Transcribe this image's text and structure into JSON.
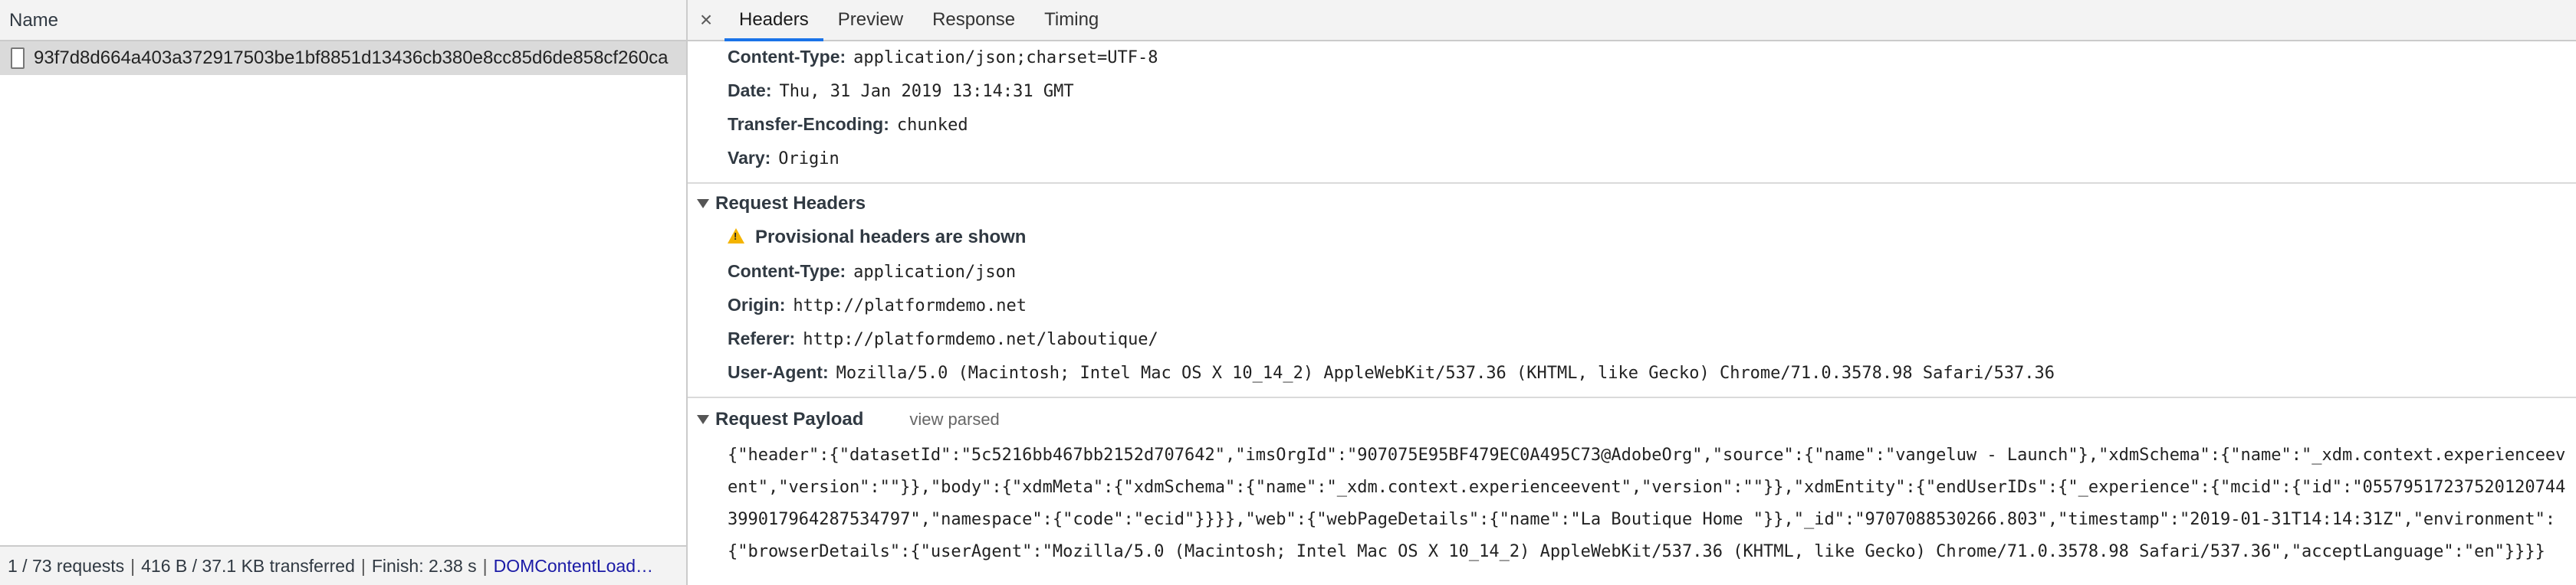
{
  "left": {
    "column_header": "Name",
    "request_name": "93f7d8d664a403a372917503be1bf8851d13436cb380e8cc85d6de858cf260ca",
    "status": {
      "requests": "1 / 73 requests",
      "transferred": "416 B / 37.1 KB transferred",
      "finish": "Finish: 2.38 s",
      "dom_content_loaded": "DOMContentLoad…"
    }
  },
  "tabs": {
    "close": "×",
    "headers": "Headers",
    "preview": "Preview",
    "response": "Response",
    "timing": "Timing"
  },
  "response_headers": [
    {
      "name": "Content-Type:",
      "value": "application/json;charset=UTF-8"
    },
    {
      "name": "Date:",
      "value": "Thu, 31 Jan 2019 13:14:31 GMT"
    },
    {
      "name": "Transfer-Encoding:",
      "value": "chunked"
    },
    {
      "name": "Vary:",
      "value": "Origin"
    }
  ],
  "request_headers": {
    "title": "Request Headers",
    "warning": "Provisional headers are shown",
    "items": [
      {
        "name": "Content-Type:",
        "value": "application/json"
      },
      {
        "name": "Origin:",
        "value": "http://platformdemo.net"
      },
      {
        "name": "Referer:",
        "value": "http://platformdemo.net/laboutique/"
      },
      {
        "name": "User-Agent:",
        "value": "Mozilla/5.0 (Macintosh; Intel Mac OS X 10_14_2) AppleWebKit/537.36 (KHTML, like Gecko) Chrome/71.0.3578.98 Safari/537.36"
      }
    ]
  },
  "request_payload": {
    "title": "Request Payload",
    "view_parsed": "view parsed",
    "lines": [
      "{\"header\":{\"datasetId\":\"5c5216bb467bb2152d707642\",\"imsOrgId\":\"907075E95BF479EC0A495C73@AdobeOrg\",\"source\":{\"name\":\"vangeluw - Launch\"},\"xdmSchema\":{\"name\":\"_xdm.context.experienceev",
      "ent\",\"version\":\"\"}},\"body\":{\"xdmMeta\":{\"xdmSchema\":{\"name\":\"_xdm.context.experienceevent\",\"version\":\"\"}},\"xdmEntity\":{\"endUserIDs\":{\"_experience\":{\"mcid\":{\"id\":\"05579517237520120744",
      "399017964287534797\",\"namespace\":{\"code\":\"ecid\"}}}},\"web\":{\"webPageDetails\":{\"name\":\"La Boutique Home \"}},\"_id\":\"9707088530266.803\",\"timestamp\":\"2019-01-31T14:14:31Z\",\"environment\":",
      "{\"browserDetails\":{\"userAgent\":\"Mozilla/5.0 (Macintosh; Intel Mac OS X 10_14_2) AppleWebKit/537.36 (KHTML, like Gecko) Chrome/71.0.3578.98 Safari/537.36\",\"acceptLanguage\":\"en\"}}}}"
    ]
  }
}
